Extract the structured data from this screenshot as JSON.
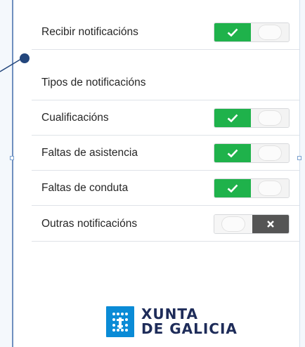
{
  "settings": {
    "receive": {
      "label": "Recibir notificacións",
      "enabled": true
    },
    "types_heading": "Tipos de notificacións",
    "items": [
      {
        "label": "Cualificacións",
        "enabled": true
      },
      {
        "label": "Faltas de asistencia",
        "enabled": true
      },
      {
        "label": "Faltas de conduta",
        "enabled": true
      },
      {
        "label": "Outras notificacións",
        "enabled": false
      }
    ]
  },
  "logo": {
    "line1": "XUNTA",
    "line2": "DE GALICIA"
  },
  "colors": {
    "toggle_on": "#1fb24b",
    "toggle_off": "#555555",
    "brand_blue": "#0a8bd6",
    "brand_text": "#1e2c59"
  },
  "icons": {
    "on": "check-icon",
    "off": "close-icon",
    "emblem": "xunta-emblem-icon"
  }
}
